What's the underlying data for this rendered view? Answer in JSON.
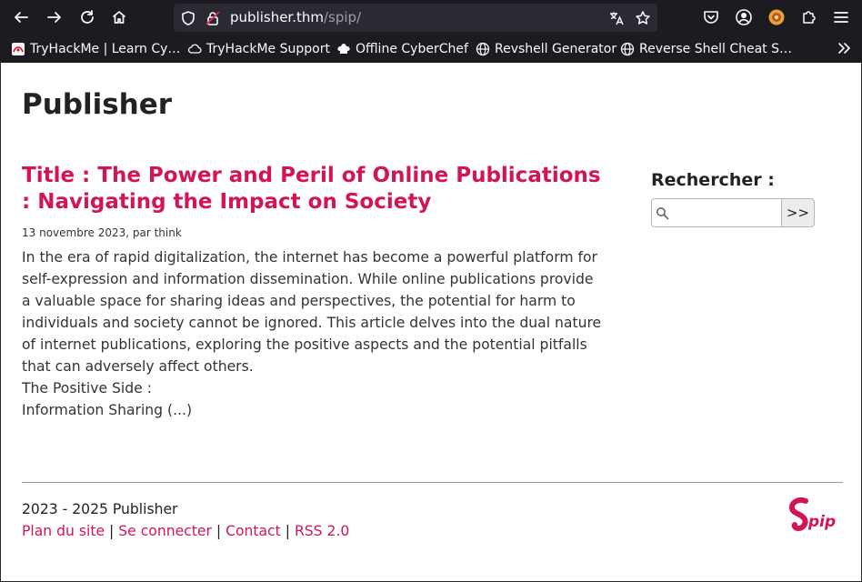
{
  "browser": {
    "url_host": "publisher.thm",
    "url_path": "/spip/",
    "bookmarks": [
      {
        "label": "TryHackMe | Learn Cy…",
        "icon": "thm-favicon"
      },
      {
        "label": "TryHackMe Support",
        "icon": "cloud-icon"
      },
      {
        "label": "Offline CyberChef",
        "icon": "chef-hat-icon"
      },
      {
        "label": "Revshell Generator",
        "icon": "globe-icon"
      },
      {
        "label": "Reverse Shell Cheat S…",
        "icon": "globe-icon"
      }
    ]
  },
  "site": {
    "title": "Publisher",
    "accent_color": "#d4145a"
  },
  "article": {
    "title": "Title : The Power and Peril of Online Publications : Navigating the Impact on Society",
    "meta": "13 novembre 2023, par think",
    "body": [
      "In the era of rapid digitalization, the internet has become a powerful platform for self-expression and information dissemination. While online publications provide a valuable space for sharing ideas and perspectives, the potential for harm to individuals and society cannot be ignored. This article delves into the dual nature of internet publications, exploring the positive aspects and the potential pitfalls that can adversely affect others.",
      "The Positive Side :",
      "Information Sharing (...)"
    ]
  },
  "search": {
    "label": "Rechercher :",
    "placeholder": "",
    "button_label": ">>"
  },
  "footer": {
    "copyright": "2023 - 2025 Publisher",
    "links": [
      "Plan du site",
      "Se connecter",
      "Contact",
      "RSS 2.0"
    ],
    "separator": "|",
    "logo_text": "pip"
  }
}
